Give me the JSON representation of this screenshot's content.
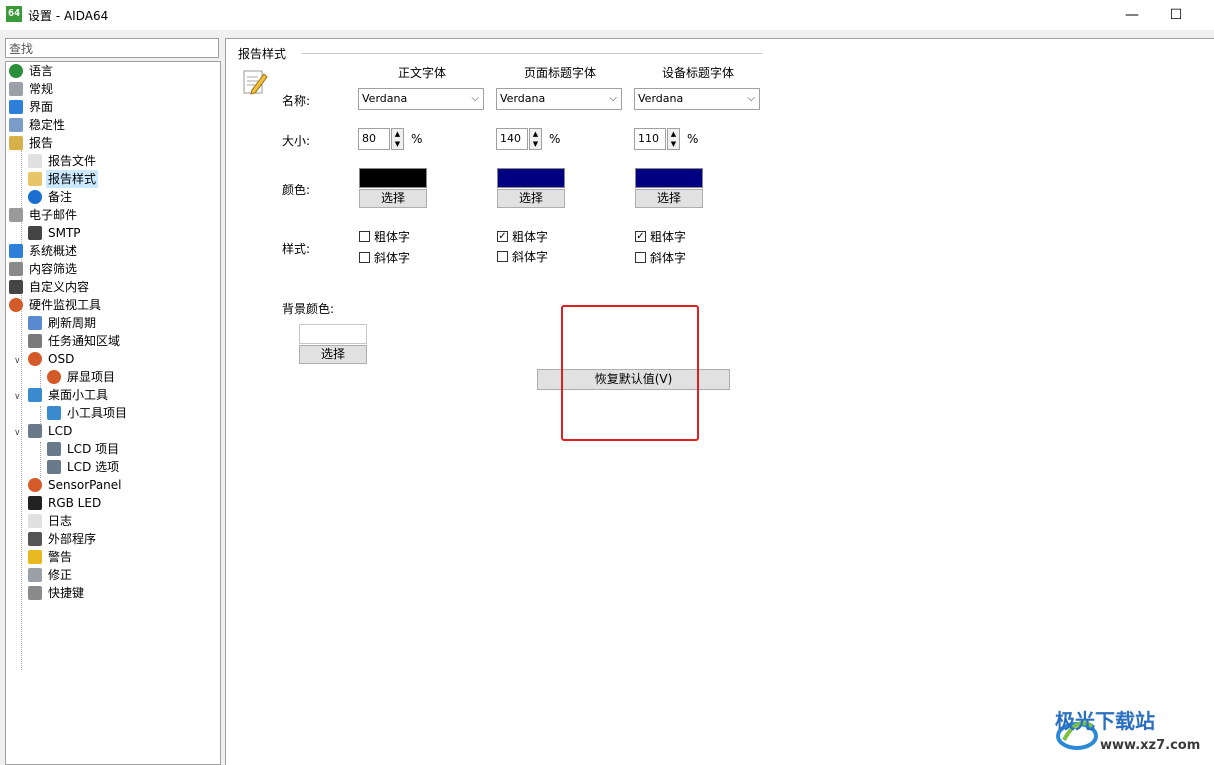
{
  "window": {
    "app_icon": "64",
    "title": "设置 - AIDA64",
    "minimize": "—",
    "maximize": "☐"
  },
  "search": {
    "placeholder": "查找"
  },
  "tree": [
    {
      "label": "语言",
      "icon": "globe-icon",
      "color": "#2a8f3a"
    },
    {
      "label": "常规",
      "icon": "general-icon",
      "color": "#9aa0a6"
    },
    {
      "label": "界面",
      "icon": "window-icon",
      "color": "#2d7fd8"
    },
    {
      "label": "稳定性",
      "icon": "gears-icon",
      "color": "#7a9cc8"
    },
    {
      "label": "报告",
      "icon": "report-icon",
      "color": "#d8b04a"
    },
    {
      "label": "报告文件",
      "icon": "file-icon",
      "color": "#e0e0e0"
    },
    {
      "label": "报告样式",
      "icon": "report-style-icon",
      "color": "#e7c66a"
    },
    {
      "label": "备注",
      "icon": "info-icon",
      "color": "#1a6fd0"
    },
    {
      "label": "电子邮件",
      "icon": "email-icon",
      "color": "#9a9a9a"
    },
    {
      "label": "SMTP",
      "icon": "phone-icon",
      "color": "#444444"
    },
    {
      "label": "系统概述",
      "icon": "monitor-icon",
      "color": "#2d7fd8"
    },
    {
      "label": "内容筛选",
      "icon": "filter-icon",
      "color": "#8a8a8a"
    },
    {
      "label": "自定义内容",
      "icon": "device-icon",
      "color": "#444444"
    },
    {
      "label": "硬件监视工具",
      "icon": "gauge-icon",
      "color": "#d45a2a"
    },
    {
      "label": "刷新周期",
      "icon": "refresh-icon",
      "color": "#5a8ad0"
    },
    {
      "label": "任务通知区域",
      "icon": "taskbar-icon",
      "color": "#7a7a7a"
    },
    {
      "label": "OSD",
      "icon": "osd-icon",
      "color": "#d45a2a"
    },
    {
      "label": "屏显项目",
      "icon": "osd-item-icon",
      "color": "#d45a2a"
    },
    {
      "label": "桌面小工具",
      "icon": "gadget-icon",
      "color": "#3a8ad0"
    },
    {
      "label": "小工具项目",
      "icon": "gadget-item-icon",
      "color": "#3a8ad0"
    },
    {
      "label": "LCD",
      "icon": "lcd-icon",
      "color": "#6a7a8a"
    },
    {
      "label": "LCD 项目",
      "icon": "lcd-item-icon",
      "color": "#6a7a8a"
    },
    {
      "label": "LCD 选项",
      "icon": "lcd-option-icon",
      "color": "#6a7a8a"
    },
    {
      "label": "SensorPanel",
      "icon": "sensorpanel-icon",
      "color": "#d45a2a"
    },
    {
      "label": "RGB LED",
      "icon": "rgb-led-icon",
      "color": "#222222"
    },
    {
      "label": "日志",
      "icon": "log-icon",
      "color": "#e0e0e0"
    },
    {
      "label": "外部程序",
      "icon": "external-program-icon",
      "color": "#555555"
    },
    {
      "label": "警告",
      "icon": "warning-icon",
      "color": "#e8b820"
    },
    {
      "label": "修正",
      "icon": "fix-icon",
      "color": "#9aa0a6"
    },
    {
      "label": "快捷键",
      "icon": "keyboard-icon",
      "color": "#8a8a8a"
    }
  ],
  "style_panel": {
    "group_title": "报告样式",
    "columns": [
      "正文字体",
      "页面标题字体",
      "设备标题字体"
    ],
    "labels": {
      "name": "名称:",
      "size": "大小:",
      "color": "颜色:",
      "style": "样式:",
      "bg_color": "背景颜色:"
    },
    "fonts": [
      "Verdana",
      "Verdana",
      "Verdana"
    ],
    "sizes": [
      "80",
      "140",
      "110"
    ],
    "percent": "%",
    "colors": [
      "#000000",
      "#000080",
      "#000080"
    ],
    "choose": "选择",
    "bold_label": "粗体字",
    "italic_label": "斜体字",
    "bold": [
      false,
      true,
      true
    ],
    "italic": [
      false,
      false,
      false
    ],
    "bg_color": "#ffffff",
    "restore_label": "恢复默认值(V)"
  },
  "watermark": {
    "name": "极光下载站",
    "url": "www.xz7.com"
  }
}
